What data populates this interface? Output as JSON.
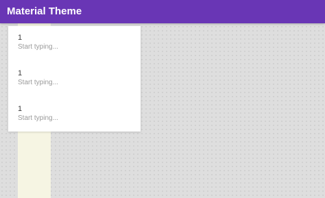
{
  "app_bar": {
    "title": "Material Theme",
    "color": "#6936b5"
  },
  "dropdown": {
    "items": [
      {
        "value": "1",
        "placeholder": "Start typing..."
      },
      {
        "value": "1",
        "placeholder": "Start typing..."
      },
      {
        "value": "1",
        "placeholder": "Start typing..."
      }
    ]
  },
  "colors": {
    "background": "#dedede",
    "strip": "#f6f5e3",
    "panel": "#ffffff"
  }
}
